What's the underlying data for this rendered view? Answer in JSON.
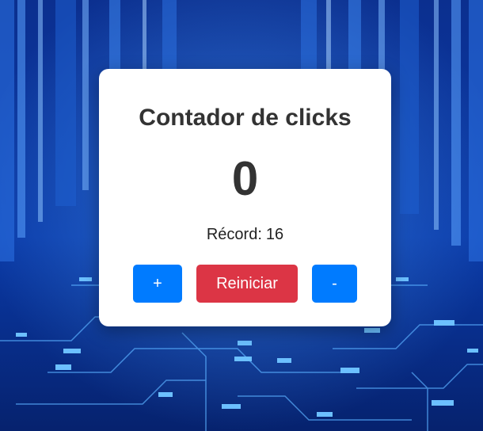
{
  "counter": {
    "title": "Contador de clicks",
    "value": "0",
    "record_label": "Récord:",
    "record_value": "16"
  },
  "buttons": {
    "increment_label": "+",
    "reset_label": "Reiniciar",
    "decrement_label": "-"
  },
  "colors": {
    "increment": "#007bff",
    "reset": "#dc3545",
    "decrement": "#007bff",
    "card": "#ffffff",
    "text": "#333333",
    "background": "#0a2a7a"
  }
}
